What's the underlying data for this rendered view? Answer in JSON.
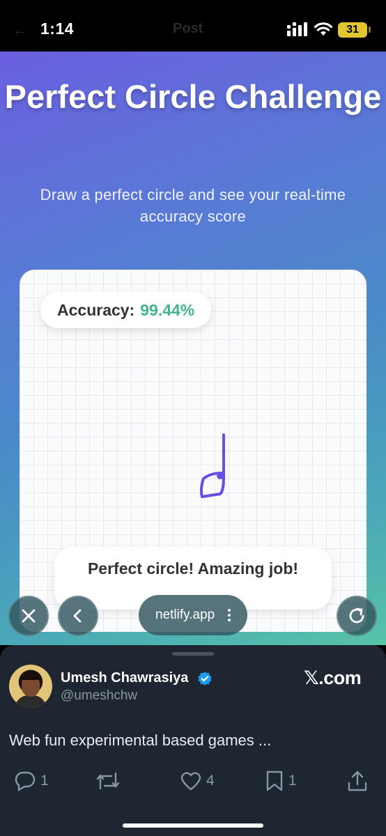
{
  "status_bar": {
    "time": "1:14",
    "background_title": "Post",
    "battery": "31",
    "battery_color": "#e2c631"
  },
  "page": {
    "title": "Perfect Circle Challenge",
    "subtitle": "Draw a perfect circle and see your real-time accuracy score",
    "gradient_colors": [
      "#6b5fe0",
      "#4a8bc8",
      "#57c3a8"
    ]
  },
  "canvas": {
    "accuracy_label": "Accuracy:",
    "accuracy_value": "99.44%",
    "accuracy_color": "#3fb68e",
    "stroke_color": "#6a4de8",
    "result_message": "Perfect circle! Amazing job!"
  },
  "browser": {
    "close_icon": "close-icon",
    "back_icon": "chevron-left-icon",
    "url": "netlify.app",
    "menu_icon": "more-vertical-icon",
    "reload_icon": "reload-icon"
  },
  "tweet": {
    "author_name": "Umesh Chawrasiya",
    "handle": "@umeshchw",
    "verified": true,
    "site": "𝕏.com",
    "text": "Web fun experimental based games ...",
    "reply_count": "1",
    "retweet_count": "",
    "like_count": "4",
    "bookmark_count": "1"
  }
}
